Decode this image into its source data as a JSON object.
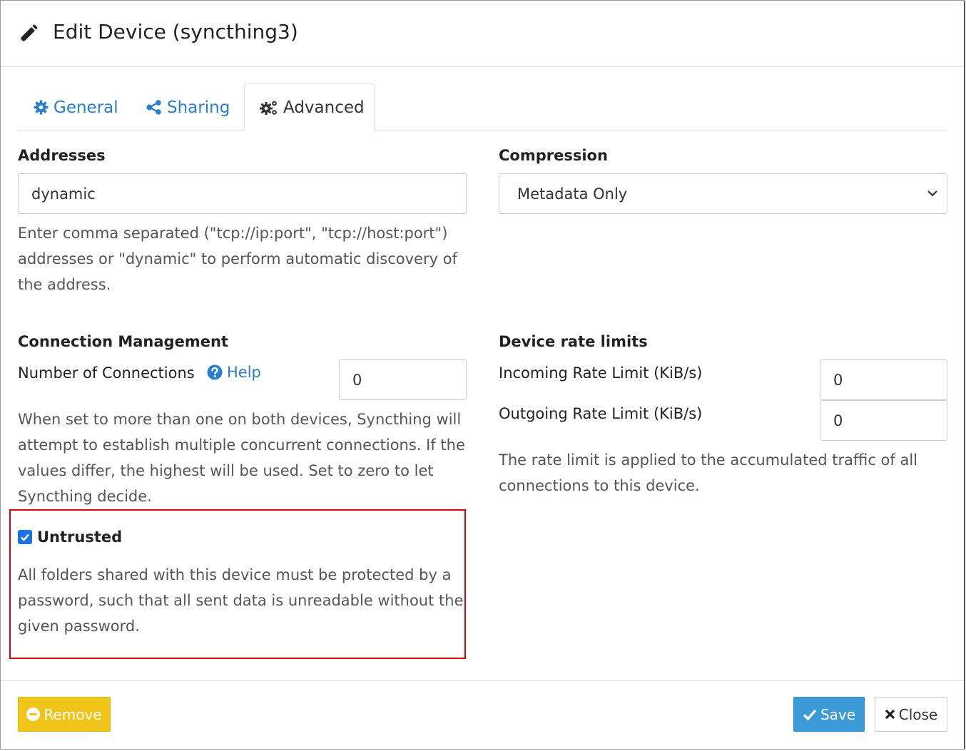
{
  "dialog": {
    "title": "Edit Device (syncthing3)"
  },
  "tabs": [
    {
      "label": "General",
      "icon": "gear-icon"
    },
    {
      "label": "Sharing",
      "icon": "share-icon"
    },
    {
      "label": "Advanced",
      "icon": "cogs-icon",
      "active": true
    }
  ],
  "addresses": {
    "label": "Addresses",
    "value": "dynamic",
    "help_line1": "Enter comma separated (\"tcp://ip:port\", \"tcp://host:port\")",
    "help_line2": "addresses or \"dynamic\" to perform automatic discovery of",
    "help_line3": "the address."
  },
  "compression": {
    "label": "Compression",
    "selected": "Metadata Only"
  },
  "connection_management": {
    "label": "Connection Management",
    "num_connections_label": "Number of Connections",
    "help_link": "Help",
    "num_connections_value": "0",
    "help_line1": "When set to more than one on both devices, Syncthing will",
    "help_line2": "attempt to establish multiple concurrent connections. If the",
    "help_line3": "values differ, the highest will be used. Set to zero to let",
    "help_line4": "Syncthing decide."
  },
  "rate_limits": {
    "label": "Device rate limits",
    "incoming_label": "Incoming Rate Limit (KiB/s)",
    "incoming_value": "0",
    "outgoing_label": "Outgoing Rate Limit (KiB/s)",
    "outgoing_value": "0",
    "help_line1": "The rate limit is applied to the accumulated traffic of all",
    "help_line2": "connections to this device."
  },
  "untrusted": {
    "label": "Untrusted",
    "checked": true,
    "help_line1": "All folders shared with this device must be protected by a",
    "help_line2": "password, such that all sent data is unreadable without the",
    "help_line3": "given password."
  },
  "footer": {
    "remove_label": "Remove",
    "save_label": "Save",
    "close_label": "Close"
  },
  "colors": {
    "link": "#2a7fcc",
    "highlight_border": "#e0000a",
    "remove_button": "#f0c419",
    "save_button": "#3d9ad9",
    "checkbox": "#1a73e8"
  }
}
